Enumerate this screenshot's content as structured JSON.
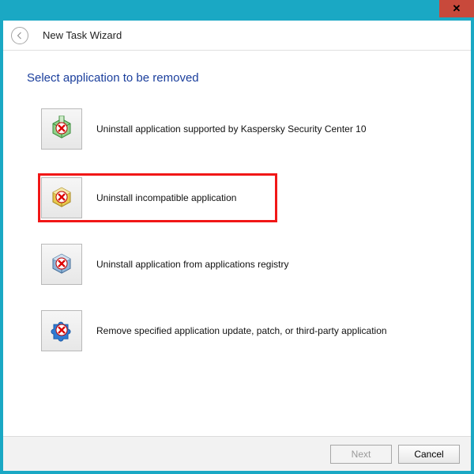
{
  "window": {
    "close_glyph": "✕"
  },
  "header": {
    "wizard_title": "New Task Wizard"
  },
  "page": {
    "heading": "Select application to be removed"
  },
  "options": [
    {
      "label": "Uninstall application supported by Kaspersky Security Center 10"
    },
    {
      "label": "Uninstall incompatible application"
    },
    {
      "label": "Uninstall application from applications registry"
    },
    {
      "label": "Remove specified application update, patch, or third-party application"
    }
  ],
  "footer": {
    "next_label": "Next",
    "cancel_label": "Cancel",
    "next_enabled": false
  }
}
